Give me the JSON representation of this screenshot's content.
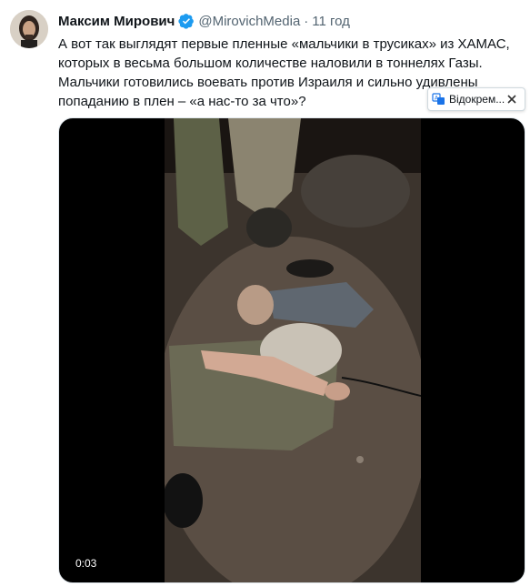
{
  "tweet": {
    "author_name": "Максим Мирович",
    "handle": "@MirovichMedia",
    "separator": "·",
    "time": "11 год",
    "text_lines": [
      "А вот так выглядят первые пленные «мальчики в трусиках» из ХАМАС,",
      "которых в весьма большом количестве наловили в тоннелях Газы.",
      "Мальчики готовились воевать против Израиля и сильно удивлены",
      "попаданию в плен – «а нас-то за что»?"
    ],
    "translate_label": "Відокрем...",
    "video_time": "0:03",
    "verified_color": "#1d9bf0"
  }
}
